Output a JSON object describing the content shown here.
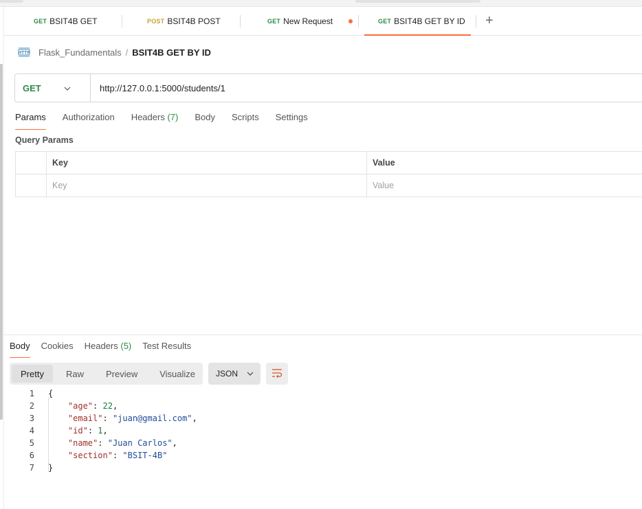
{
  "tabs": [
    {
      "method": "GET",
      "name": "BSIT4B GET"
    },
    {
      "method": "POST",
      "name": "BSIT4B POST"
    },
    {
      "method": "GET",
      "name": "New Request"
    },
    {
      "method": "GET",
      "name": "BSIT4B GET BY ID"
    }
  ],
  "tabs_plus": "+",
  "breadcrumb": {
    "collection": "Flask_Fundamentals",
    "separator": "/",
    "request": "BSIT4B GET BY ID"
  },
  "request": {
    "method": "GET",
    "url": "http://127.0.0.1:5000/students/1"
  },
  "request_tabs": {
    "params": "Params",
    "authorization": "Authorization",
    "headers": "Headers",
    "headers_count": "(7)",
    "body": "Body",
    "scripts": "Scripts",
    "settings": "Settings"
  },
  "query_params": {
    "title": "Query Params",
    "col_key": "Key",
    "col_value": "Value",
    "ph_key": "Key",
    "ph_value": "Value"
  },
  "response_tabs": {
    "body": "Body",
    "cookies": "Cookies",
    "headers": "Headers",
    "headers_count": "(5)",
    "test_results": "Test Results"
  },
  "view_modes": {
    "pretty": "Pretty",
    "raw": "Raw",
    "preview": "Preview",
    "visualize": "Visualize"
  },
  "format": "JSON",
  "response_body": [
    {
      "line": "1",
      "parts": [
        [
          "p",
          "{"
        ]
      ]
    },
    {
      "line": "2",
      "parts": [
        [
          "p",
          "    "
        ],
        [
          "k",
          "\"age\""
        ],
        [
          "p",
          ": "
        ],
        [
          "n",
          "22"
        ],
        [
          "p",
          ","
        ]
      ]
    },
    {
      "line": "3",
      "parts": [
        [
          "p",
          "    "
        ],
        [
          "k",
          "\"email\""
        ],
        [
          "p",
          ": "
        ],
        [
          "s",
          "\"juan@gmail.com\""
        ],
        [
          "p",
          ","
        ]
      ]
    },
    {
      "line": "4",
      "parts": [
        [
          "p",
          "    "
        ],
        [
          "k",
          "\"id\""
        ],
        [
          "p",
          ": "
        ],
        [
          "n",
          "1"
        ],
        [
          "p",
          ","
        ]
      ]
    },
    {
      "line": "5",
      "parts": [
        [
          "p",
          "    "
        ],
        [
          "k",
          "\"name\""
        ],
        [
          "p",
          ": "
        ],
        [
          "s",
          "\"Juan Carlos\""
        ],
        [
          "p",
          ","
        ]
      ]
    },
    {
      "line": "6",
      "parts": [
        [
          "p",
          "    "
        ],
        [
          "k",
          "\"section\""
        ],
        [
          "p",
          ": "
        ],
        [
          "s",
          "\"BSIT-4B\""
        ]
      ]
    },
    {
      "line": "7",
      "parts": [
        [
          "p",
          "}"
        ]
      ]
    }
  ],
  "colors": {
    "accent": "#ff6c37",
    "get": "#2c8a47",
    "post": "#c9a431"
  }
}
